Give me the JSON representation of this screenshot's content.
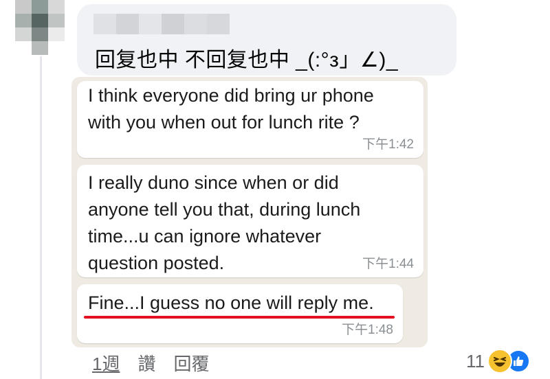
{
  "comment": {
    "text": "回复也中 不回复也中 _(:°з」∠)_"
  },
  "chat": {
    "messages": [
      {
        "lines": [
          "I think everyone did bring ur phone",
          "with you when out for lunch rite ?"
        ],
        "time": "下午1:42"
      },
      {
        "lines": [
          "I really duno since when or did",
          "anyone tell you that, during lunch",
          "time...u can ignore whatever",
          "question posted."
        ],
        "time": "下午1:44"
      },
      {
        "lines": [
          "Fine...I guess no one will reply me."
        ],
        "time": "下午1:48",
        "highlighted": true
      }
    ]
  },
  "actions": {
    "time": "1週",
    "like": "讚",
    "reply": "回覆"
  },
  "reactions": {
    "count": "11",
    "types": [
      "haha-icon",
      "like-icon"
    ]
  },
  "colors": {
    "comment_bg": "#f0f2f5",
    "chat_bg": "#efeae2",
    "underline": "#e3101f",
    "like_blue": "#1877f2",
    "haha_yellow": "#f7c22f"
  }
}
